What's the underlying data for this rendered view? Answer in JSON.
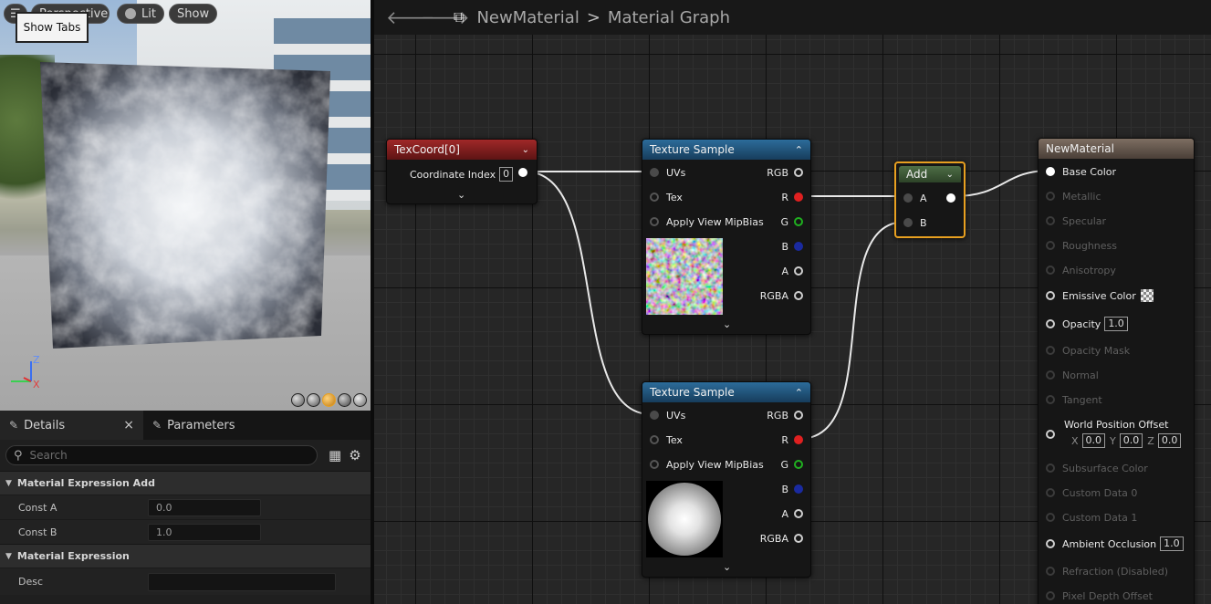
{
  "viewport": {
    "buttons": {
      "menu": "☰",
      "perspective": "Perspective",
      "lit": "Lit",
      "show": "Show"
    },
    "tooltip": "Show Tabs",
    "axis": {
      "z": "Z",
      "x": "X"
    }
  },
  "details": {
    "tabs": [
      {
        "label": "Details",
        "close": "×"
      },
      {
        "label": "Parameters"
      }
    ],
    "search_placeholder": "Search",
    "sections": [
      {
        "title": "Material Expression Add",
        "props": [
          {
            "name": "Const A",
            "value": "0.0"
          },
          {
            "name": "Const B",
            "value": "1.0"
          }
        ]
      },
      {
        "title": "Material Expression",
        "props": [
          {
            "name": "Desc",
            "value": ""
          }
        ]
      }
    ]
  },
  "graph": {
    "breadcrumb": {
      "asset": "NewMaterial",
      "separator": ">",
      "graph": "Material Graph"
    },
    "texcoord": {
      "title": "TexCoord[0]",
      "pin_label": "Coordinate Index",
      "pin_value": "0"
    },
    "texture1": {
      "title": "Texture Sample",
      "inputs": [
        "UVs",
        "Tex",
        "Apply View MipBias"
      ],
      "outputs": [
        "RGB",
        "R",
        "G",
        "B",
        "A",
        "RGBA"
      ]
    },
    "texture2": {
      "title": "Texture Sample",
      "inputs": [
        "UVs",
        "Tex",
        "Apply View MipBias"
      ],
      "outputs": [
        "RGB",
        "R",
        "G",
        "B",
        "A",
        "RGBA"
      ]
    },
    "add": {
      "title": "Add",
      "inputs": [
        "A",
        "B"
      ]
    },
    "material": {
      "title": "NewMaterial",
      "pins": [
        {
          "label": "Base Color",
          "enabled": true
        },
        {
          "label": "Metallic",
          "enabled": false
        },
        {
          "label": "Specular",
          "enabled": false
        },
        {
          "label": "Roughness",
          "enabled": false
        },
        {
          "label": "Anisotropy",
          "enabled": false
        },
        {
          "label": "Emissive Color",
          "enabled": true
        },
        {
          "label": "Opacity",
          "enabled": true,
          "value": "1.0"
        },
        {
          "label": "Opacity Mask",
          "enabled": false
        },
        {
          "label": "Normal",
          "enabled": false
        },
        {
          "label": "Tangent",
          "enabled": false
        },
        {
          "label": "World Position Offset",
          "enabled": true
        },
        {
          "label": "Subsurface Color",
          "enabled": false
        },
        {
          "label": "Custom Data 0",
          "enabled": false
        },
        {
          "label": "Custom Data 1",
          "enabled": false
        },
        {
          "label": "Ambient Occlusion",
          "enabled": true,
          "value": "1.0"
        },
        {
          "label": "Refraction (Disabled)",
          "enabled": false
        },
        {
          "label": "Pixel Depth Offset",
          "enabled": false
        }
      ],
      "wpo": {
        "x_label": "X",
        "x": "0.0",
        "y_label": "Y",
        "y": "0.0",
        "z_label": "Z",
        "z": "0.0"
      }
    }
  },
  "colors": {
    "add_selected": "#e8a020",
    "pin_r": "#e02020",
    "pin_g": "#20b020",
    "pin_b": "#1a2aa0"
  }
}
